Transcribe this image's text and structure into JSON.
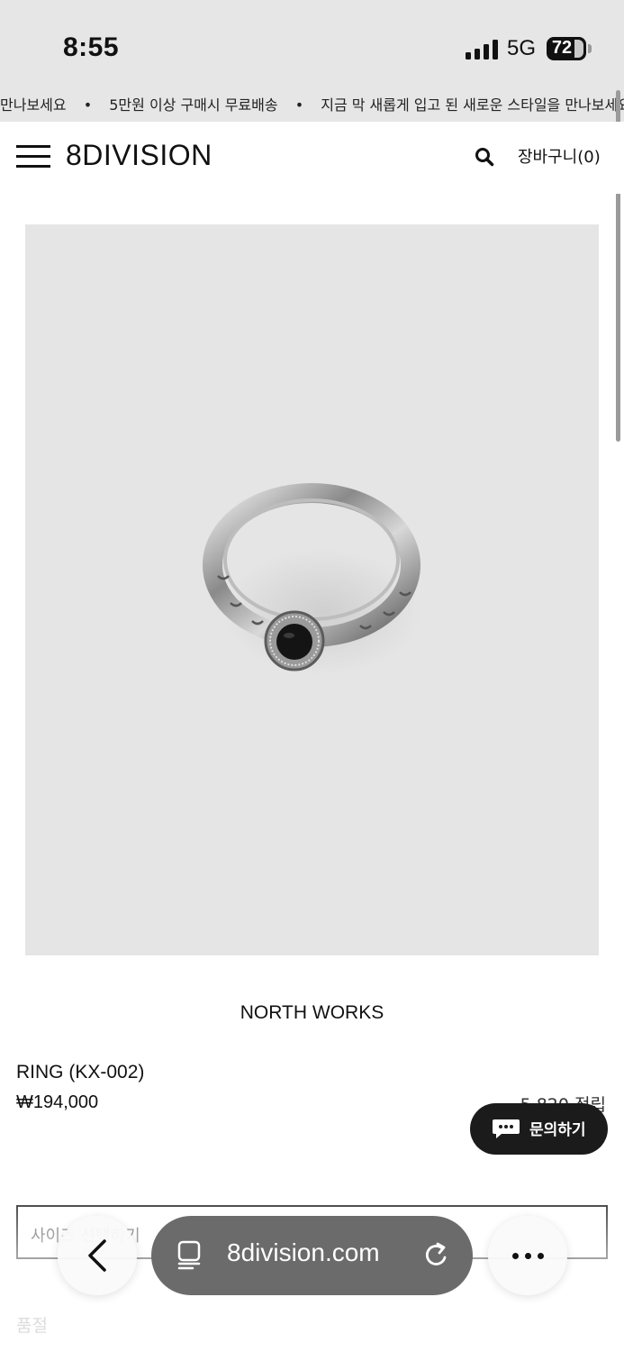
{
  "status_bar": {
    "time": "8:55",
    "network": "5G",
    "battery": "72"
  },
  "marquee": {
    "items": [
      "만나보세요",
      "•",
      "5만원 이상 구매시 무료배송",
      "•",
      "지금 막 새롭게 입고 된 새로운 스타일을 만나보세요"
    ]
  },
  "header": {
    "logo": "8DIVISION",
    "cart_label": "장바구니(0)"
  },
  "product": {
    "image_icon": "ring-image",
    "brand": "NORTH WORKS",
    "name": "RING (KX-002)",
    "price": "₩194,000",
    "points": "5,820 적립"
  },
  "chat": {
    "label": "문의하기",
    "icon": "chat-bubble-icon"
  },
  "option": {
    "placeholder": "사이즈 선택하기"
  },
  "stock_status": "품절",
  "browser": {
    "url": "8division.com"
  },
  "colors": {
    "status_bg": "#e6e6e6",
    "image_bg": "#e5e5e5",
    "chat_bg": "#1b1b1b",
    "url_bar_bg": "#6b6b6b"
  }
}
